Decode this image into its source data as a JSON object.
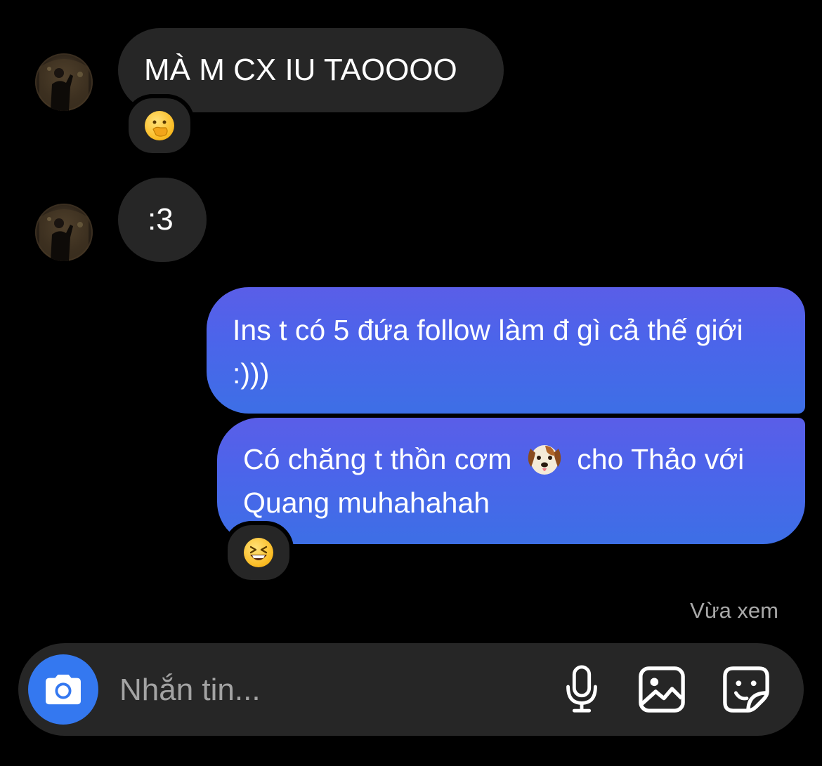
{
  "messages": {
    "incoming_1": {
      "text": "MÀ M CX IU TAOOOO",
      "reaction": "hand-over-mouth-emoji"
    },
    "incoming_2": {
      "text": ":3"
    },
    "outgoing_1": {
      "text": "Ins t có 5 đứa follow làm đ gì cả thế giới :)))"
    },
    "outgoing_2": {
      "text_before": "Có chăng t thồn cơm",
      "emoji": "dog-face-emoji",
      "text_after": "cho Thảo với Quang muhahahah",
      "reaction": "grinning-squinting-face-emoji"
    }
  },
  "status": {
    "seen": "Vừa xem"
  },
  "composer": {
    "placeholder": "Nhắn tin...",
    "icons": [
      "camera-icon",
      "microphone-icon",
      "gallery-icon",
      "sticker-icon"
    ]
  },
  "colors": {
    "background": "#000000",
    "incoming_bubble": "#262626",
    "outgoing_gradient_top": "#5a5ee8",
    "outgoing_gradient_bottom": "#3d6fe6",
    "camera_button": "#3478f0"
  }
}
